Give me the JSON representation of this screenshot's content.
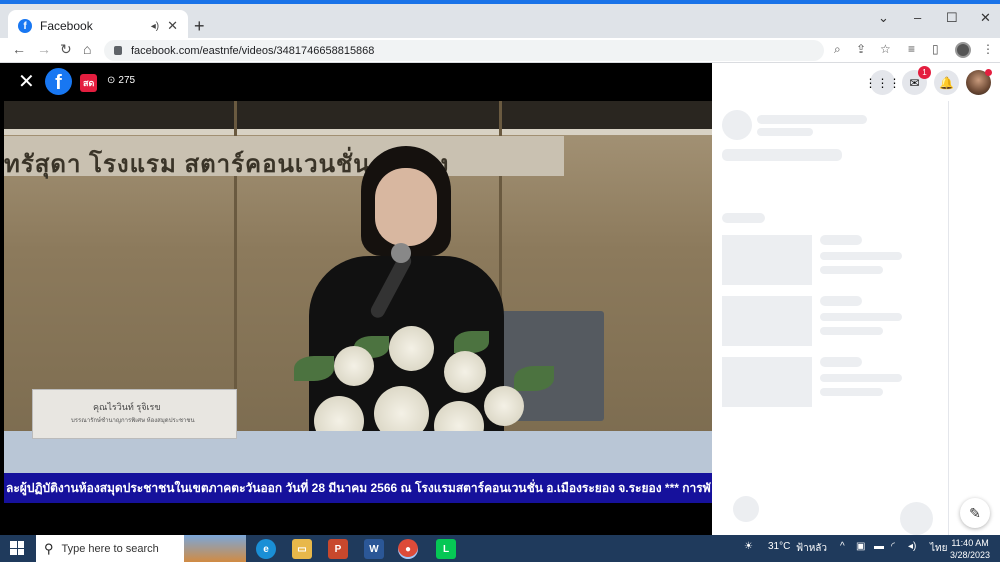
{
  "browser": {
    "tab_title": "Facebook",
    "tab_favicon": "f",
    "tab_audio": "◂)",
    "tab_close": "✕",
    "new_tab": "+",
    "url": "facebook.com/eastnfe/videos/3481746658815868",
    "window_controls": [
      "⌄",
      "–",
      "☐",
      "✕"
    ]
  },
  "video": {
    "close": "✕",
    "logo": "f",
    "live_badge": "สด",
    "viewer_count": "275",
    "banner_text": "ทรัสุดา โรงแรม สตาร์คอนเวนชั่น ระยอง",
    "nameplate_line1": "คุณไรวินท์ รุจิเรข",
    "nameplate_line2": "บรรณารักษ์ชำนาญการพิเศษ ห้องสมุดประชาชน",
    "ticker": "ละผู้ปฏิบัติงานห้องสมุดประชาชนในเขตภาคตะวันออก วันที่ 28 มีนาคม 2566 ณ โรงแรมสตาร์คอนเวนชั่น อ.เมืองระยอง จ.ระยอง    *** การพั"
  },
  "right_panel": {
    "menu_icon": "⋮⋮⋮",
    "messenger_icon": "✉",
    "messenger_badge": "1",
    "notifications_icon": "🔔",
    "compose_icon": "✎"
  },
  "taskbar": {
    "search_placeholder": "Type here to search",
    "weather_temp": "31°C",
    "weather_text": "ฟ้าหลัว",
    "language": "ไทย",
    "time": "11:40 AM",
    "date": "3/28/2023"
  },
  "colors": {
    "facebook_blue": "#1877f2",
    "live_red": "#e41e3f",
    "ticker_bg": "#16119c",
    "taskbar_bg": "#1f3a5c"
  }
}
